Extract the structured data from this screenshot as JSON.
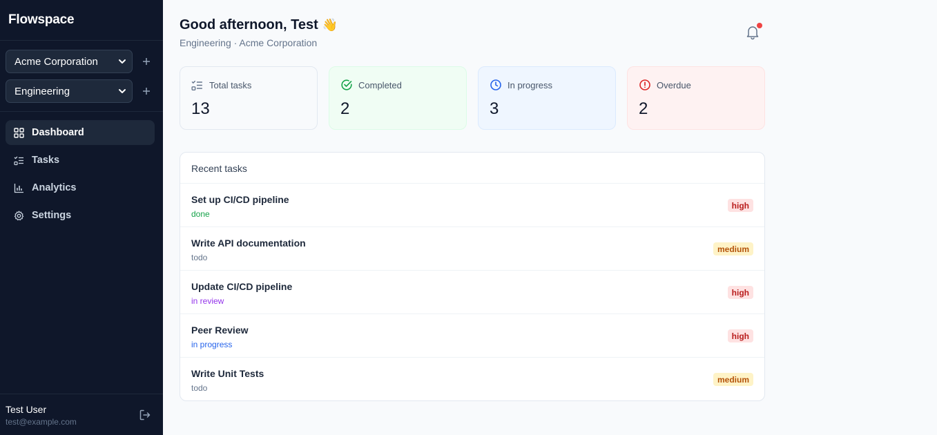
{
  "sidebar": {
    "brand": "Flowspace",
    "org_select": "Acme Corporation",
    "team_select": "Engineering",
    "nav": [
      {
        "label": "Dashboard",
        "icon": "grid-icon",
        "active": true
      },
      {
        "label": "Tasks",
        "icon": "list-check-icon",
        "active": false
      },
      {
        "label": "Analytics",
        "icon": "bar-chart-icon",
        "active": false
      },
      {
        "label": "Settings",
        "icon": "gear-icon",
        "active": false
      }
    ],
    "user": {
      "name": "Test User",
      "email": "test@example.com"
    }
  },
  "header": {
    "greeting": "Good afternoon, Test",
    "emoji": "👋",
    "subtitle": "Engineering · Acme Corporation"
  },
  "stats": [
    {
      "label": "Total tasks",
      "value": "13",
      "icon": "list-check-icon",
      "bg": "#f8fafc",
      "border": "#e2e8f0",
      "icon_color": "#64748b"
    },
    {
      "label": "Completed",
      "value": "2",
      "icon": "check-circle-icon",
      "bg": "#f0fdf4",
      "border": "#dcfce7",
      "icon_color": "#16a34a"
    },
    {
      "label": "In progress",
      "value": "3",
      "icon": "clock-icon",
      "bg": "#eff6ff",
      "border": "#dbeafe",
      "icon_color": "#2563eb"
    },
    {
      "label": "Overdue",
      "value": "2",
      "icon": "alert-circle-icon",
      "bg": "#fef2f2",
      "border": "#fee2e2",
      "icon_color": "#dc2626"
    }
  ],
  "recent": {
    "title": "Recent tasks",
    "tasks": [
      {
        "title": "Set up CI/CD pipeline",
        "status": "done",
        "status_color": "#16a34a",
        "priority": "high"
      },
      {
        "title": "Write API documentation",
        "status": "todo",
        "status_color": "#64748b",
        "priority": "medium"
      },
      {
        "title": "Update CI/CD pipeline",
        "status": "in review",
        "status_color": "#9333ea",
        "priority": "high"
      },
      {
        "title": "Peer Review",
        "status": "in progress",
        "status_color": "#2563eb",
        "priority": "high"
      },
      {
        "title": "Write Unit Tests",
        "status": "todo",
        "status_color": "#64748b",
        "priority": "medium"
      }
    ]
  },
  "priority_colors": {
    "high": {
      "bg": "#fee2e2",
      "fg": "#b91c1c"
    },
    "medium": {
      "bg": "#fef3c7",
      "fg": "#b45309"
    }
  }
}
